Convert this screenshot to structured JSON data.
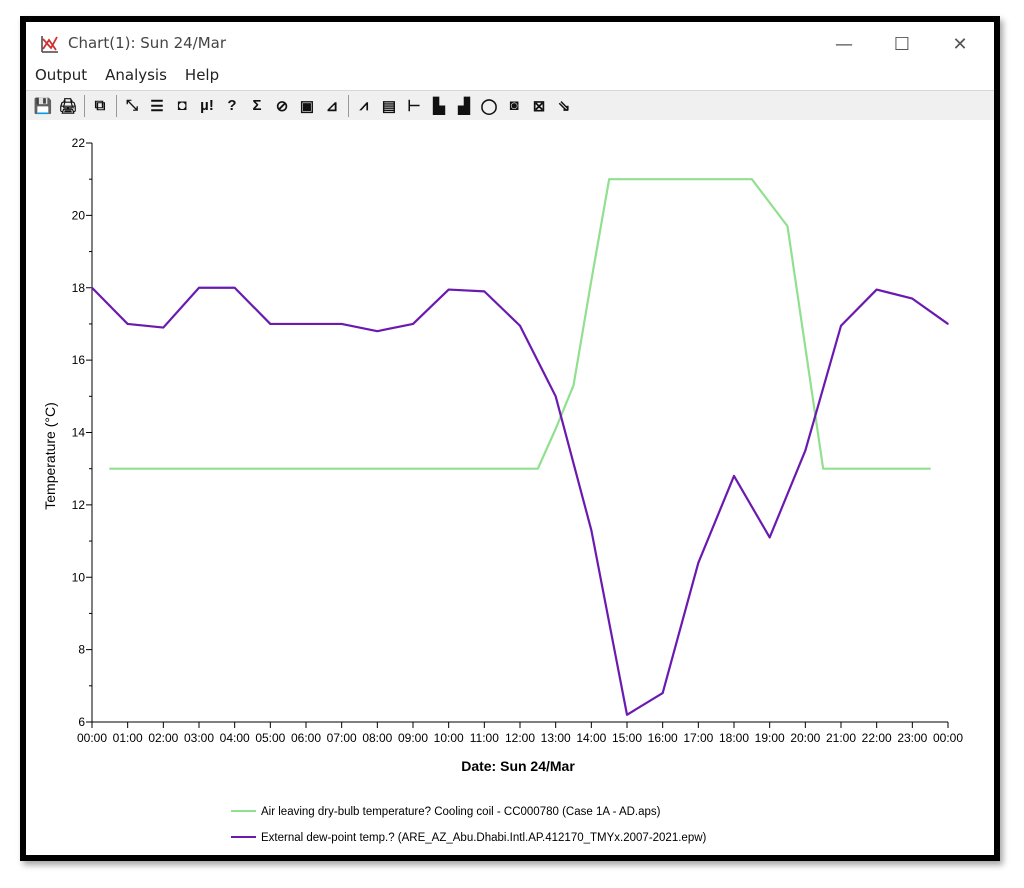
{
  "window": {
    "title": "Chart(1): Sun 24/Mar",
    "minimize_glyph": "—",
    "maximize_glyph": "☐",
    "close_glyph": "✕"
  },
  "menu": [
    "Output",
    "Analysis",
    "Help"
  ],
  "toolbar_icons": [
    {
      "name": "save-icon",
      "glyph": "💾"
    },
    {
      "name": "print-icon",
      "glyph": "🖨"
    },
    {
      "sep": true
    },
    {
      "name": "copy-icon",
      "glyph": "⧉"
    },
    {
      "sep": true
    },
    {
      "name": "chart-icon",
      "glyph": "⤡"
    },
    {
      "name": "table-icon",
      "glyph": "☰"
    },
    {
      "name": "camera-icon",
      "glyph": "◘"
    },
    {
      "name": "mu-icon",
      "glyph": "µ!"
    },
    {
      "name": "query-icon",
      "glyph": "?"
    },
    {
      "name": "sum-icon",
      "glyph": "Σ"
    },
    {
      "name": "gauge-icon",
      "glyph": "⊘"
    },
    {
      "name": "report-icon",
      "glyph": "▣"
    },
    {
      "name": "analysis-icon",
      "glyph": "⊿"
    },
    {
      "sep": true
    },
    {
      "name": "line-chart-icon",
      "glyph": "⩘"
    },
    {
      "name": "area-chart-icon",
      "glyph": "▤"
    },
    {
      "name": "floating-bar-icon",
      "glyph": "⊢"
    },
    {
      "name": "stacked-bar-icon",
      "glyph": "▙"
    },
    {
      "name": "bar-chart-icon",
      "glyph": "▟"
    },
    {
      "name": "pie-chart-icon",
      "glyph": "◯"
    },
    {
      "name": "contour-icon",
      "glyph": "◙"
    },
    {
      "name": "scatter-icon",
      "glyph": "⊠"
    },
    {
      "name": "export-icon",
      "glyph": "⇘"
    }
  ],
  "colors": {
    "series1": "#90e090",
    "series2": "#6a1ab0"
  },
  "chart_data": {
    "type": "line",
    "xlabel": "Date: Sun 24/Mar",
    "ylabel": "Temperature (°C)",
    "ylim": [
      6,
      22
    ],
    "yticks": [
      6,
      8,
      10,
      12,
      14,
      16,
      18,
      20,
      22
    ],
    "xtick_labels": [
      "00:00",
      "01:00",
      "02:00",
      "03:00",
      "04:00",
      "05:00",
      "06:00",
      "07:00",
      "08:00",
      "09:00",
      "10:00",
      "11:00",
      "12:00",
      "13:00",
      "14:00",
      "15:00",
      "16:00",
      "17:00",
      "18:00",
      "19:00",
      "20:00",
      "21:00",
      "22:00",
      "23:00",
      "00:00"
    ],
    "xlim_hours": [
      0,
      24
    ],
    "grid": false,
    "legend_placement": "bottom",
    "series": [
      {
        "name": "Air leaving dry-bulb temperature? Cooling coil - CC000780 (Case 1A - AD.aps)",
        "x_hours": [
          0.5,
          12.5,
          13,
          13.5,
          14,
          14.5,
          18.5,
          19.5,
          20.5,
          23.5
        ],
        "values": [
          13,
          13,
          14.1,
          15.3,
          18.2,
          21,
          21,
          19.7,
          13,
          13
        ]
      },
      {
        "name": "External dew-point temp.?  (ARE_AZ_Abu.Dhabi.Intl.AP.412170_TMYx.2007-2021.epw)",
        "x_hours": [
          0,
          1,
          2,
          3,
          4,
          5,
          6,
          7,
          8,
          9,
          10,
          11,
          12,
          13,
          14,
          15,
          16,
          17,
          18,
          19,
          20,
          21,
          22,
          23,
          24
        ],
        "values": [
          18,
          17,
          16.9,
          18,
          18,
          17,
          17,
          17,
          16.8,
          17,
          17.95,
          17.9,
          16.95,
          15,
          11.3,
          6.2,
          6.8,
          10.4,
          12.8,
          11.1,
          13.5,
          16.95,
          17.95,
          17.7,
          17
        ]
      }
    ]
  }
}
